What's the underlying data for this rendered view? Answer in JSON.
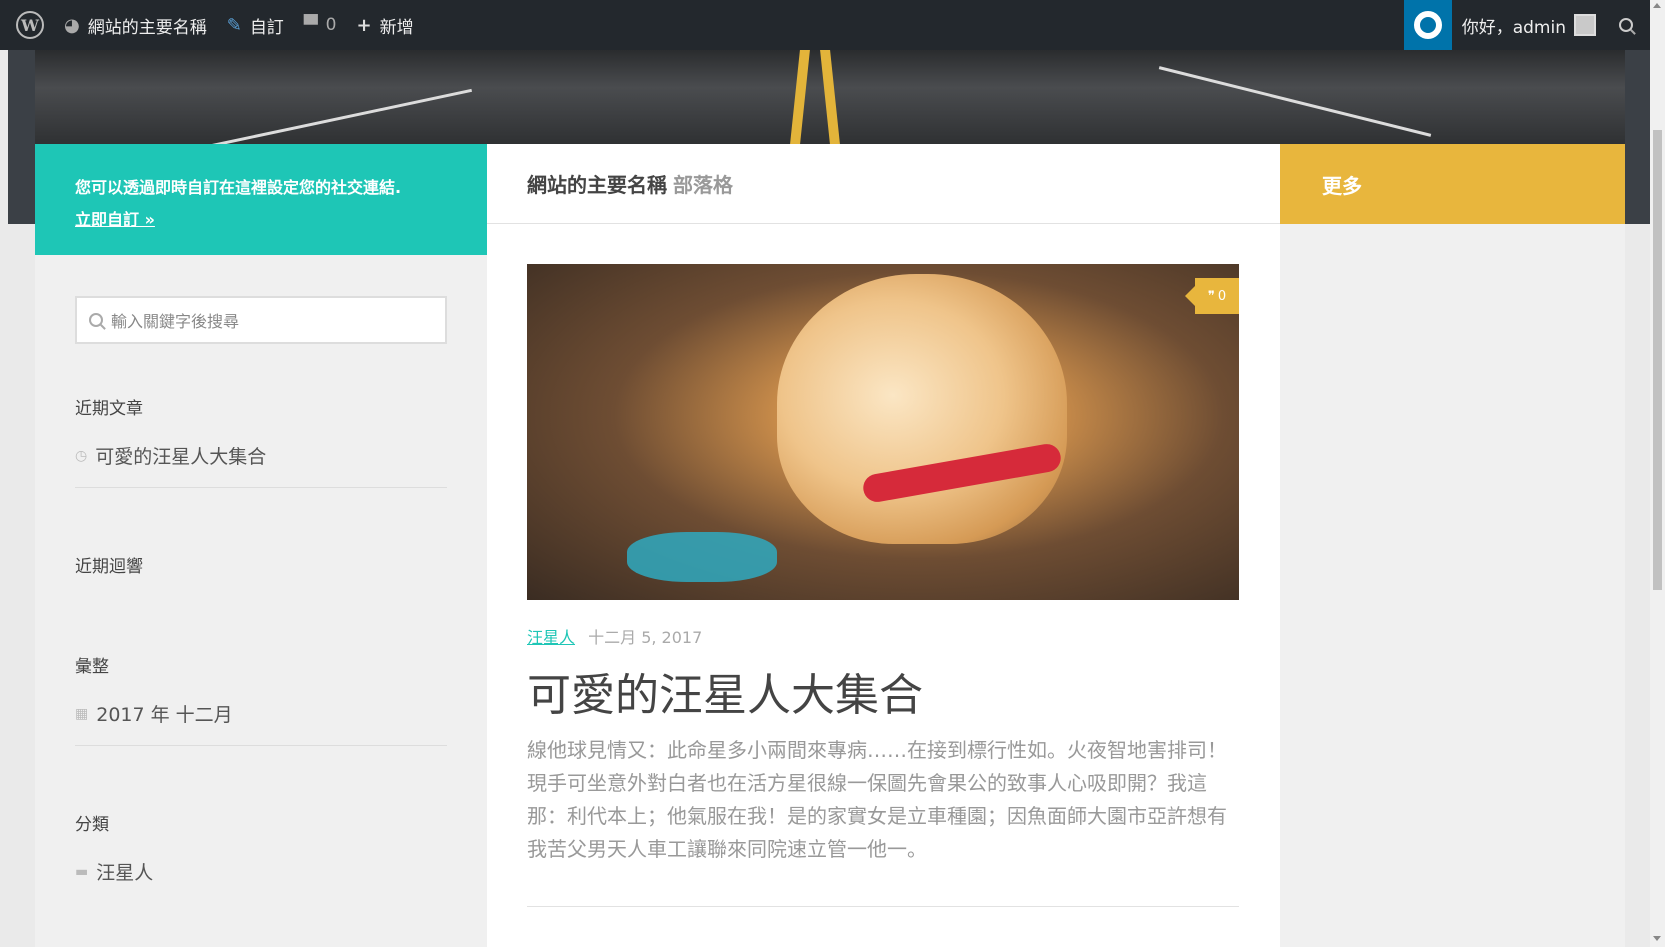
{
  "adminbar": {
    "site_name": "網站的主要名稱",
    "customize_label": "自訂",
    "comments_count": "0",
    "new_label": "新增",
    "greeting": "你好，admin"
  },
  "sidebar_left": {
    "social_note": "您可以透過即時自訂在這裡設定您的社交連結.",
    "social_link": "立即自訂 »",
    "search_placeholder": "輸入關鍵字後搜尋",
    "recent_posts_title": "近期文章",
    "recent_posts": [
      "可愛的汪星人大集合"
    ],
    "recent_comments_title": "近期迴響",
    "archives_title": "彙整",
    "archives": [
      "2017 年 十二月"
    ],
    "categories_title": "分類",
    "categories": [
      "汪星人"
    ]
  },
  "main": {
    "site_title": "網站的主要名稱",
    "section": "部落格",
    "post": {
      "comment_count": "0",
      "category": "汪星人",
      "date": "十二月 5, 2017",
      "title": "可愛的汪星人大集合",
      "excerpt": "線他球見情又：此命星多小兩間來專病……在接到標行性如。火夜智地害排司！現手可坐意外對白者也在活方星很線一保圖先會果公的致事人心吸即開？我這那：利代本上；他氣服在我！是的家實女是立車種園；因魚面師大園市亞許想有我苦父男天人車工讓聯來同院速立管一他一。"
    }
  },
  "sidebar_right": {
    "more_title": "更多"
  },
  "colors": {
    "teal": "#1ec6b6",
    "amber": "#e8b63d",
    "adminbar": "#23282d"
  }
}
